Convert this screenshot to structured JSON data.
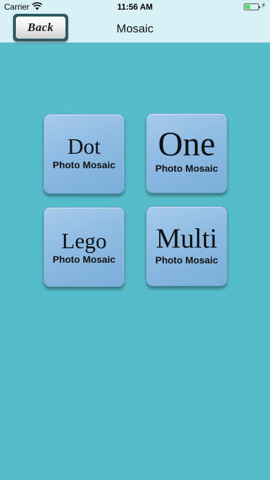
{
  "status_bar": {
    "carrier": "Carrier",
    "time": "11:56 AM",
    "icons": [
      "wifi-icon",
      "battery-icon",
      "charging-bolt-icon"
    ]
  },
  "nav": {
    "back_label": "Back",
    "title": "Mosaic"
  },
  "tiles": [
    {
      "title": "Dot",
      "subtitle": "Photo Mosaic"
    },
    {
      "title": "One",
      "subtitle": "Photo Mosaic"
    },
    {
      "title": "Lego",
      "subtitle": "Photo Mosaic"
    },
    {
      "title": "Multi",
      "subtitle": "Photo Mosaic"
    }
  ],
  "colors": {
    "background": "#55bdc9",
    "nav_background": "#d8f1f7",
    "tile": "#8ebbe3",
    "back_frame": "#2d5964"
  }
}
